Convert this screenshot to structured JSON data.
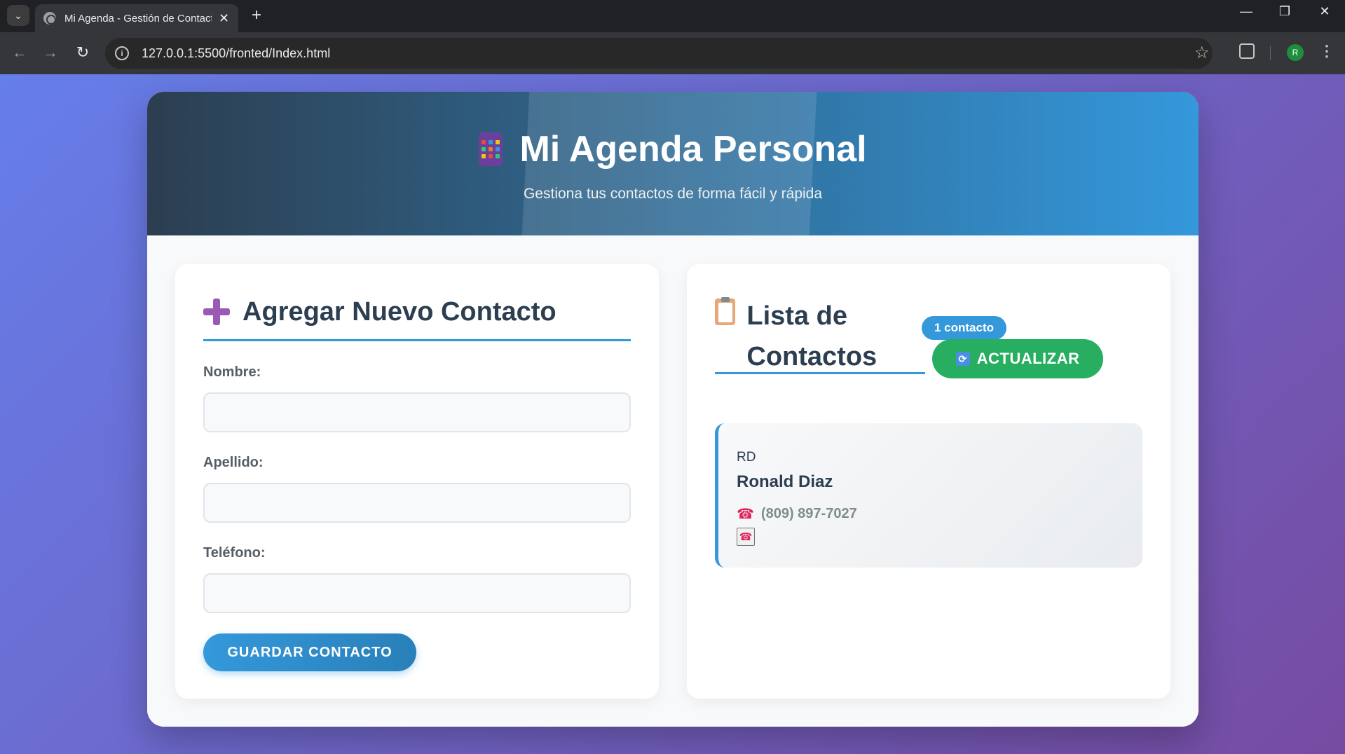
{
  "browser": {
    "tab_title": "Mi Agenda - Gestión de Contactos",
    "url": "127.0.0.1:5500/fronted/Index.html",
    "profile_initial": "R"
  },
  "header": {
    "title": "Mi Agenda Personal",
    "subtitle": "Gestiona tus contactos de forma fácil y rápida"
  },
  "form": {
    "title": "Agregar Nuevo Contacto",
    "fields": [
      {
        "label": "Nombre:",
        "value": "",
        "placeholder": ""
      },
      {
        "label": "Apellido:",
        "value": "",
        "placeholder": ""
      },
      {
        "label": "Teléfono:",
        "value": "",
        "placeholder": ""
      }
    ],
    "submit_label": "GUARDAR CONTACTO"
  },
  "list": {
    "title": "Lista de Contactos",
    "count_badge": "1 contacto",
    "refresh_label": "ACTUALIZAR",
    "contacts": [
      {
        "initials": "RD",
        "name": "Ronald Diaz",
        "phone": "(809) 897-7027"
      }
    ]
  },
  "colors": {
    "accent": "#3498db",
    "success": "#27ae60",
    "heading": "#2c3e50",
    "bg_gradient_start": "#667eea",
    "bg_gradient_end": "#764ba2"
  },
  "icons": {
    "header": "abacus-icon",
    "form": "plus-icon",
    "list": "clipboard-icon",
    "refresh": "refresh-icon",
    "phone": "phone-icon"
  }
}
